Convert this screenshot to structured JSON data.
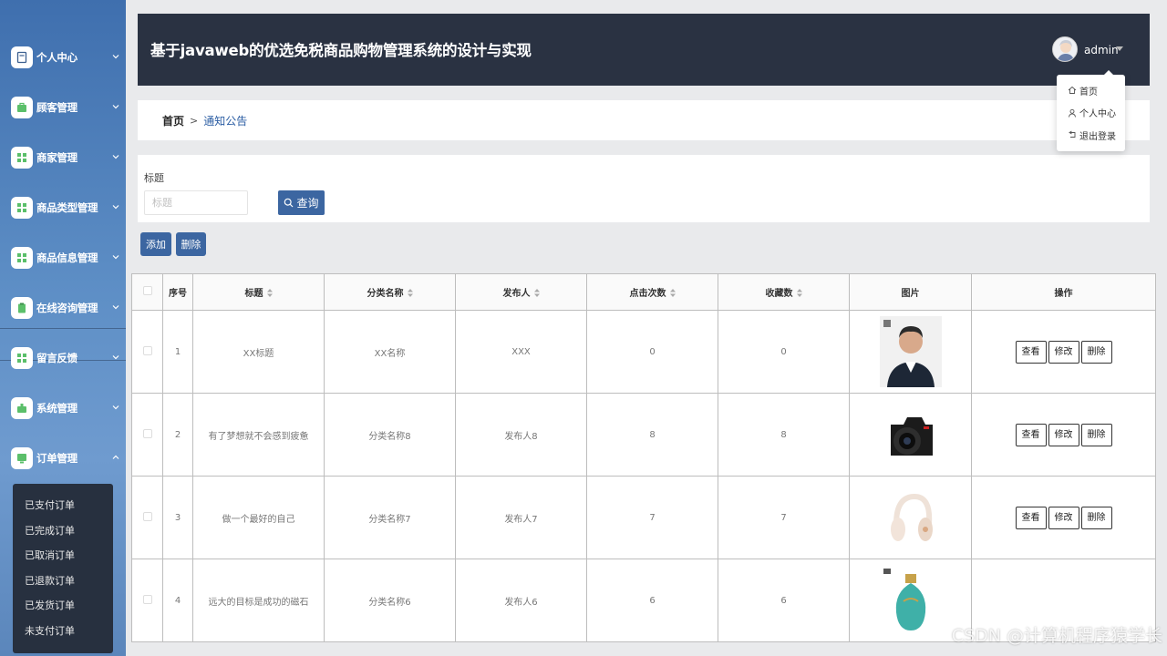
{
  "sidebar": {
    "items": [
      {
        "label": "个人中心",
        "icon": "document-icon"
      },
      {
        "label": "顾客管理",
        "icon": "bag-icon"
      },
      {
        "label": "商家管理",
        "icon": "grid-icon"
      },
      {
        "label": "商品类型管理",
        "icon": "grid-icon"
      },
      {
        "label": "商品信息管理",
        "icon": "grid-icon"
      },
      {
        "label": "在线咨询管理",
        "icon": "clipboard-icon"
      },
      {
        "label": "留言反馈",
        "icon": "grid-icon"
      },
      {
        "label": "系统管理",
        "icon": "box-icon"
      },
      {
        "label": "订单管理",
        "icon": "monitor-icon"
      }
    ],
    "order_submenu": [
      "已支付订单",
      "已完成订单",
      "已取消订单",
      "已退款订单",
      "已发货订单",
      "未支付订单"
    ]
  },
  "header": {
    "title": "基于javaweb的优选免税商品购物管理系统的设计与实现",
    "user": "admin"
  },
  "user_menu": [
    "首页",
    "个人中心",
    "退出登录"
  ],
  "breadcrumb": {
    "home": "首页",
    "separator": ">",
    "current": "通知公告"
  },
  "search": {
    "label": "标题",
    "placeholder": "标题",
    "button": "查询"
  },
  "actions": {
    "add": "添加",
    "delete": "删除"
  },
  "table": {
    "headers": [
      "序号",
      "标题",
      "分类名称",
      "发布人",
      "点击次数",
      "收藏数",
      "图片",
      "操作"
    ],
    "row_buttons": [
      "查看",
      "修改",
      "删除"
    ],
    "rows": [
      {
        "no": "1",
        "title": "XX标题",
        "category": "XX名称",
        "publisher": "XXX",
        "clicks": "0",
        "favorites": "0",
        "image": "portrait-photo"
      },
      {
        "no": "2",
        "title": "有了梦想就不会感到疲惫",
        "category": "分类名称8",
        "publisher": "发布人8",
        "clicks": "8",
        "favorites": "8",
        "image": "camera-photo"
      },
      {
        "no": "3",
        "title": "做一个最好的自己",
        "category": "分类名称7",
        "publisher": "发布人7",
        "clicks": "7",
        "favorites": "7",
        "image": "headphones-photo"
      },
      {
        "no": "4",
        "title": "远大的目标是成功的磁石",
        "category": "分类名称6",
        "publisher": "发布人6",
        "clicks": "6",
        "favorites": "6",
        "image": "perfume-photo"
      }
    ]
  },
  "watermark": "CSDN @计算机程序猿学长",
  "colors": {
    "sidebar": "#4a7ab8",
    "header": "#2a3242",
    "primary_button": "#3c66a1",
    "link": "#2b5da3",
    "submenu": "#27303f"
  }
}
